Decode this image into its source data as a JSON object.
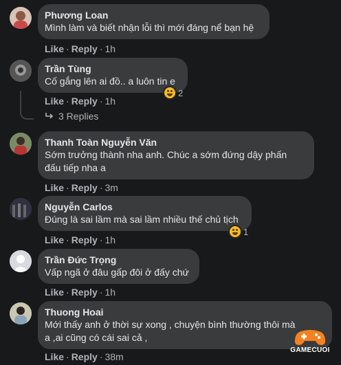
{
  "comments": [
    {
      "name": "Phương Loan",
      "lines": [
        "Mình làm và biết nhận lỗi thì mới đáng nể bạn hệ"
      ],
      "like": "Like",
      "reply": "Reply",
      "time": "1h"
    },
    {
      "name": "Trần Tùng",
      "lines": [
        "Cố gắng lên ai đồ.. a luôn tin e"
      ],
      "like": "Like",
      "reply": "Reply",
      "time": "1h",
      "reaction_count": "2",
      "replies_label": "3 Replies"
    },
    {
      "name": "Thanh Toàn Nguyễn Văn",
      "lines": [
        "Sớm trưởng thành nha anh. Chúc a sớm đứng dậy phấn",
        "đấu tiếp nha a"
      ],
      "like": "Like",
      "reply": "Reply",
      "time": "3m"
    },
    {
      "name": "Nguyễn Carlos",
      "lines": [
        "Đúng là sai lầm mà sai lầm nhiều thế chủ tịch"
      ],
      "like": "Like",
      "reply": "Reply",
      "time": "1h",
      "reaction_count": "1"
    },
    {
      "name": "Trần Đức Trọng",
      "lines": [
        "Vấp ngã ở đâu gấp đôi ở đấy chứ"
      ],
      "like": "Like",
      "reply": "Reply",
      "time": "1h"
    },
    {
      "name": "Thuong Hoai",
      "lines": [
        "Mới thấy anh ở thời sự xong , chuyện bình thường thôi mà",
        "a ,ai cũng có cái sai cả ,"
      ],
      "like": "Like",
      "reply": "Reply",
      "time": "38m"
    }
  ],
  "watermark": "GAMECUOI",
  "colors": {
    "background": "#18191a",
    "bubble": "#3a3b3c",
    "text": "#e4e6eb",
    "muted": "#b0b3b8",
    "reaction": "#f7b928",
    "watermark_orange": "#f58220"
  }
}
